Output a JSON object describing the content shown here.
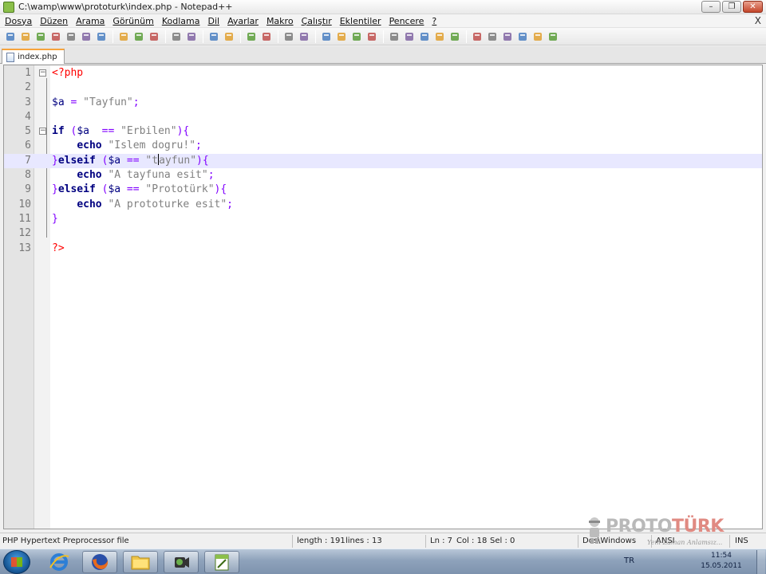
{
  "window": {
    "title": "C:\\wamp\\www\\prototurk\\index.php - Notepad++",
    "minimize_label": "–",
    "restore_label": "❐",
    "close_label": "✕"
  },
  "menu": {
    "items": [
      {
        "label": "Dosya"
      },
      {
        "label": "Düzen"
      },
      {
        "label": "Arama"
      },
      {
        "label": "Görünüm"
      },
      {
        "label": "Kodlama"
      },
      {
        "label": "Dil"
      },
      {
        "label": "Ayarlar"
      },
      {
        "label": "Makro"
      },
      {
        "label": "Çalıştır"
      },
      {
        "label": "Eklentiler"
      },
      {
        "label": "Pencere"
      },
      {
        "label": "?"
      }
    ],
    "close_doc_label": "X"
  },
  "toolbar": {
    "icons": [
      "new-file-icon",
      "open-file-icon",
      "save-icon",
      "save-all-icon",
      "close-icon",
      "close-all-icon",
      "print-icon",
      "cut-icon",
      "copy-icon",
      "paste-icon",
      "undo-icon",
      "redo-icon",
      "find-icon",
      "replace-icon",
      "zoom-in-icon",
      "zoom-out-icon",
      "sync-v-icon",
      "sync-h-icon",
      "word-wrap-icon",
      "show-all-chars-icon",
      "indent-guide-icon",
      "user-lang-icon",
      "record-macro-icon",
      "stop-record-icon",
      "play-macro-icon",
      "run-macro-multiple-icon",
      "save-macro-icon",
      "sort-icon",
      "up-icon",
      "down-icon",
      "trim-icon",
      "eraser-icon",
      "spellcheck-icon"
    ]
  },
  "tab": {
    "label": "index.php"
  },
  "editor": {
    "current_line": 7,
    "lines": [
      {
        "num": "1",
        "fold": "⊟",
        "tokens": [
          {
            "t": "<?php",
            "c": "php"
          }
        ]
      },
      {
        "num": "2",
        "tokens": []
      },
      {
        "num": "3",
        "tokens": [
          {
            "t": "$a",
            "c": "var"
          },
          {
            "t": " = ",
            "c": "op"
          },
          {
            "t": "\"Tayfun\"",
            "c": "str"
          },
          {
            "t": ";",
            "c": "op"
          }
        ]
      },
      {
        "num": "4",
        "tokens": []
      },
      {
        "num": "5",
        "fold": "⊟",
        "tokens": [
          {
            "t": "if",
            "c": "kw"
          },
          {
            "t": " (",
            "c": "op"
          },
          {
            "t": "$a",
            "c": "var"
          },
          {
            "t": "  == ",
            "c": "op"
          },
          {
            "t": "\"Erbilen\"",
            "c": "str"
          },
          {
            "t": "){",
            "c": "op"
          }
        ]
      },
      {
        "num": "6",
        "tokens": [
          {
            "t": "    ",
            "c": "plain"
          },
          {
            "t": "echo",
            "c": "kw"
          },
          {
            "t": " ",
            "c": "plain"
          },
          {
            "t": "\"Islem dogru!\"",
            "c": "str"
          },
          {
            "t": ";",
            "c": "op"
          }
        ]
      },
      {
        "num": "7",
        "tokens": [
          {
            "t": "}",
            "c": "op"
          },
          {
            "t": "elseif",
            "c": "kw"
          },
          {
            "t": " (",
            "c": "op"
          },
          {
            "t": "$a",
            "c": "var"
          },
          {
            "t": " == ",
            "c": "op"
          },
          {
            "t": "\"t",
            "c": "str"
          },
          {
            "t": "|",
            "c": "caret"
          },
          {
            "t": "ayfun\"",
            "c": "str"
          },
          {
            "t": "){",
            "c": "op"
          }
        ]
      },
      {
        "num": "8",
        "tokens": [
          {
            "t": "    ",
            "c": "plain"
          },
          {
            "t": "echo",
            "c": "kw"
          },
          {
            "t": " ",
            "c": "plain"
          },
          {
            "t": "\"A tayfuna esit\"",
            "c": "str"
          },
          {
            "t": ";",
            "c": "op"
          }
        ]
      },
      {
        "num": "9",
        "tokens": [
          {
            "t": "}",
            "c": "op"
          },
          {
            "t": "elseif",
            "c": "kw"
          },
          {
            "t": " (",
            "c": "op"
          },
          {
            "t": "$a",
            "c": "var"
          },
          {
            "t": " == ",
            "c": "op"
          },
          {
            "t": "\"Prototürk\"",
            "c": "str"
          },
          {
            "t": "){",
            "c": "op"
          }
        ]
      },
      {
        "num": "10",
        "tokens": [
          {
            "t": "    ",
            "c": "plain"
          },
          {
            "t": "echo",
            "c": "kw"
          },
          {
            "t": " ",
            "c": "plain"
          },
          {
            "t": "\"A prototurke esit\"",
            "c": "str"
          },
          {
            "t": ";",
            "c": "op"
          }
        ]
      },
      {
        "num": "11",
        "tokens": [
          {
            "t": "}",
            "c": "op"
          }
        ]
      },
      {
        "num": "12",
        "tokens": []
      },
      {
        "num": "13",
        "tokens": [
          {
            "t": "?>",
            "c": "php"
          }
        ]
      }
    ]
  },
  "status": {
    "file_type": "PHP Hypertext Preprocessor file",
    "length": "length : 191",
    "lines": "lines : 13",
    "ln": "Ln : 7",
    "col": "Col : 18",
    "sel": "Sel : 0",
    "eol": "Dos\\Windows",
    "encoding": "ANSI",
    "mode": "INS"
  },
  "watermark": {
    "brand_left": "PROTO",
    "brand_right": "TÜRK",
    "tagline": "Yeni Zaman Anlamsız..."
  },
  "taskbar": {
    "language": "TR",
    "time": "11:54",
    "date": "15.05.2011"
  },
  "colors": {
    "php_tag": "#ff0000",
    "keyword": "#000080",
    "string": "#808080",
    "operator": "#8000ff",
    "current_line": "#e8e8ff"
  }
}
